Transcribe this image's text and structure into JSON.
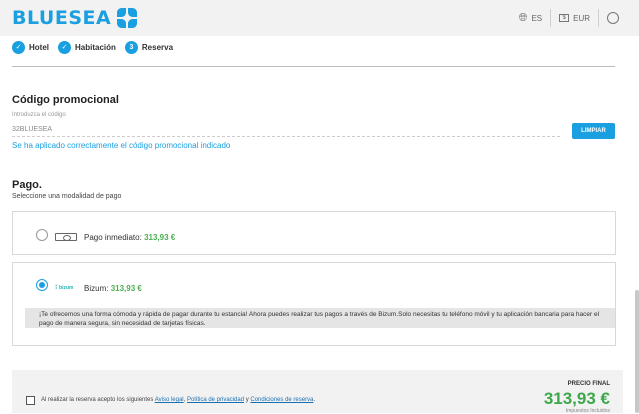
{
  "header": {
    "brand": "BLUESEA",
    "language": "ES",
    "currency": "EUR",
    "icons": [
      "bluesea-logo-icon",
      "globe-icon",
      "currency-icon",
      "user-icon"
    ]
  },
  "steps": [
    {
      "label": "Hotel",
      "marker": "✓"
    },
    {
      "label": "Habitación",
      "marker": "✓"
    },
    {
      "label": "Reserva",
      "marker": "3"
    }
  ],
  "promo": {
    "title": "Código promocional",
    "field_label": "Introduzca el código",
    "value": "32BLUESEA",
    "button_label": "LIMPIAR",
    "success_message": "Se ha aplicado correctamente el código promocional indicado"
  },
  "payment": {
    "title": "Pago.",
    "subtitle": "Seleccione una modalidad de pago",
    "options": [
      {
        "label": "Pago inmediato:",
        "price": "313,93 €",
        "selected": false,
        "icon": "cash-icon"
      },
      {
        "label": "Bizum:",
        "price": "313,93 €",
        "selected": true,
        "icon": "bizum-logo-icon",
        "logo_text": "bizum",
        "description": "¡Te ofrecemos una forma cómoda y rápida de pagar durante tu estancia! Ahora puedes realizar tus pagos a través de Bizum.Solo necesitas tu teléfono móvil y tu aplicación bancaria para hacer el pago de manera segura, sin necesidad de tarjetas físicas."
      }
    ]
  },
  "footer": {
    "terms_prefix": "Al realizar la reserva acepto los siguientes",
    "link_legal": "Aviso legal",
    "link_privacy": "Política de privacidad",
    "conj": "y",
    "link_conditions": "Condiciones de reserva",
    "terms_suffix": ".",
    "final_price_label": "PRECIO FINAL",
    "final_price": "313,93 €",
    "tax_note": "Impuestos Incluidos"
  },
  "colors": {
    "accent": "#1a9fe0",
    "price_green": "#4caf50",
    "final_price_green": "#3ca84a"
  }
}
